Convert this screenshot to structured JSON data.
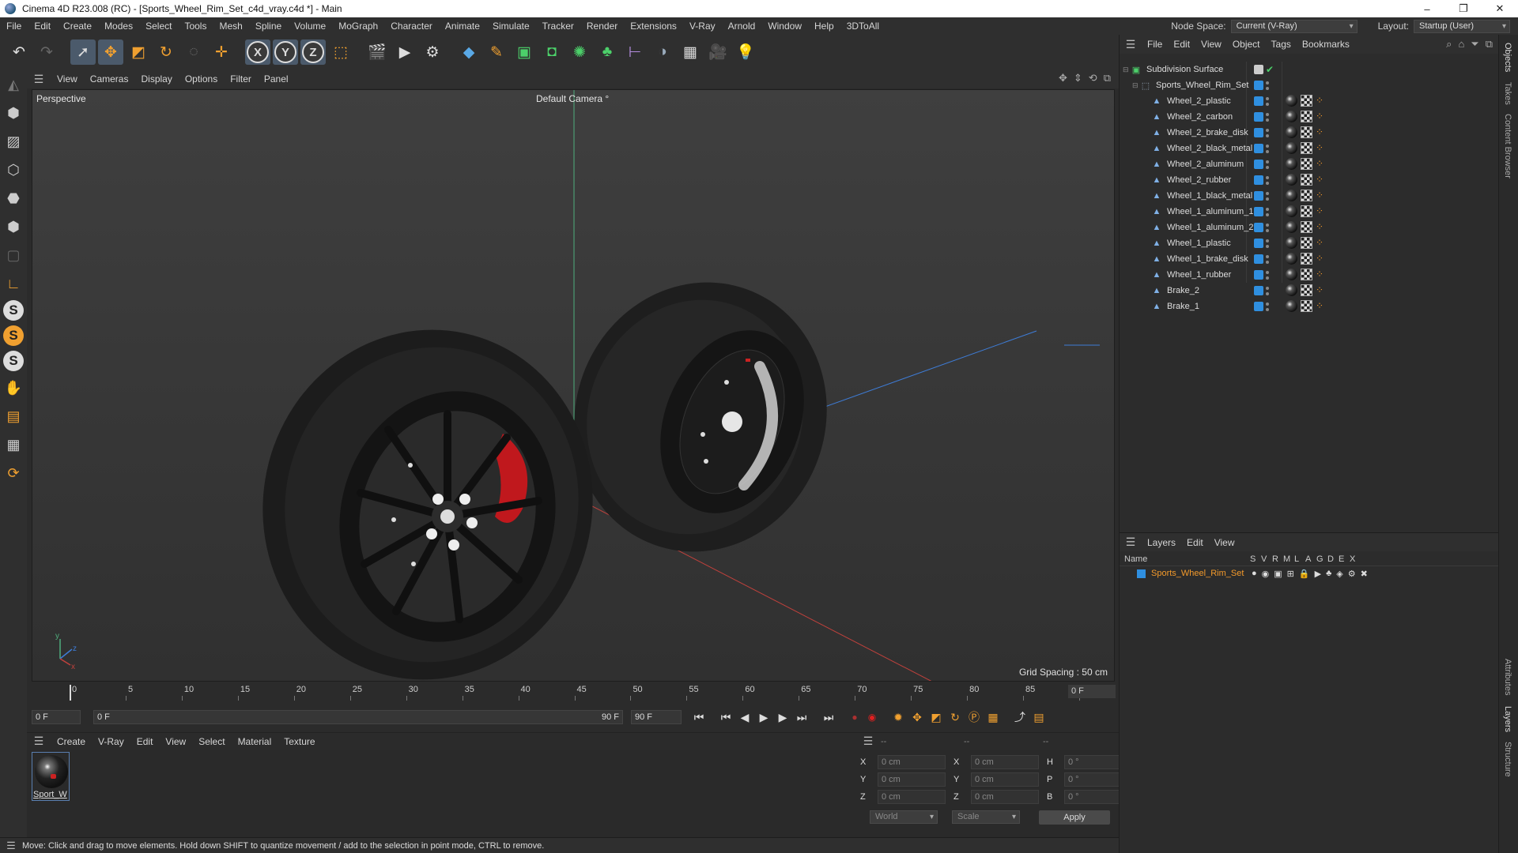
{
  "window": {
    "title": "Cinema 4D R23.008 (RC) - [Sports_Wheel_Rim_Set_c4d_vray.c4d *] - Main",
    "minimize": "–",
    "maximize": "❐",
    "close": "✕"
  },
  "menubar": {
    "items": [
      "File",
      "Edit",
      "Create",
      "Modes",
      "Select",
      "Tools",
      "Mesh",
      "Spline",
      "Volume",
      "MoGraph",
      "Character",
      "Animate",
      "Simulate",
      "Tracker",
      "Render",
      "Extensions",
      "V-Ray",
      "Arnold",
      "Window",
      "Help",
      "3DToAll"
    ],
    "node_space_label": "Node Space:",
    "node_space_value": "Current (V-Ray)",
    "layout_label": "Layout:",
    "layout_value": "Startup (User)"
  },
  "viewport": {
    "menu": [
      "View",
      "Cameras",
      "Display",
      "Options",
      "Filter",
      "Panel"
    ],
    "view_name": "Perspective",
    "camera_name": "Default Camera",
    "grid_spacing": "Grid Spacing : 50 cm",
    "axis_y": "y",
    "axis_z": "z",
    "axis_x": "x"
  },
  "timeline": {
    "ticks": [
      "0",
      "5",
      "10",
      "15",
      "20",
      "25",
      "30",
      "35",
      "40",
      "45",
      "50",
      "55",
      "60",
      "65",
      "70",
      "75",
      "80",
      "85",
      "90"
    ],
    "end_frame": "0 F"
  },
  "transport": {
    "start_field": "0 F",
    "range_start": "0 F",
    "range_end": "90 F",
    "end_field": "90 F"
  },
  "material_panel": {
    "menu": [
      "Create",
      "V-Ray",
      "Edit",
      "View",
      "Select",
      "Material",
      "Texture"
    ],
    "material_name": "Sport_W"
  },
  "coordinates": {
    "header": [
      "--",
      "--",
      "--"
    ],
    "rows": [
      {
        "l1": "X",
        "v1": "0 cm",
        "l2": "X",
        "v2": "0 cm",
        "l3": "H",
        "v3": "0 °"
      },
      {
        "l1": "Y",
        "v1": "0 cm",
        "l2": "Y",
        "v2": "0 cm",
        "l3": "P",
        "v3": "0 °"
      },
      {
        "l1": "Z",
        "v1": "0 cm",
        "l2": "Z",
        "v2": "0 cm",
        "l3": "B",
        "v3": "0 °"
      }
    ],
    "space_value": "World",
    "mode_value": "Scale",
    "apply_label": "Apply"
  },
  "status": {
    "message": "Move: Click and drag to move elements. Hold down SHIFT to quantize movement / add to the selection in point mode, CTRL to remove."
  },
  "object_manager": {
    "menu": [
      "File",
      "Edit",
      "View",
      "Object",
      "Tags",
      "Bookmarks"
    ],
    "root": "Subdivision Surface",
    "group": "Sports_Wheel_Rim_Set",
    "objects": [
      "Wheel_2_plastic",
      "Wheel_2_carbon",
      "Wheel_2_brake_disk",
      "Wheel_2_black_metal",
      "Wheel_2_aluminum",
      "Wheel_2_rubber",
      "Wheel_1_black_metal",
      "Wheel_1_aluminum_1",
      "Wheel_1_aluminum_2",
      "Wheel_1_plastic",
      "Wheel_1_brake_disk",
      "Wheel_1_rubber",
      "Brake_2",
      "Brake_1"
    ]
  },
  "layers": {
    "menu": [
      "Layers",
      "Edit",
      "View"
    ],
    "name_header": "Name",
    "columns": [
      "S",
      "V",
      "R",
      "M",
      "L",
      "A",
      "G",
      "D",
      "E",
      "X"
    ],
    "layer_name": "Sports_Wheel_Rim_Set"
  },
  "side_tabs": [
    "Objects",
    "Takes",
    "Content Browser",
    "Attributes",
    "Layers",
    "Structure"
  ],
  "colors": {
    "accent_blue": "#2f8fe0",
    "layer_orange": "#f39a2b",
    "selection": "#4b5a6b"
  }
}
